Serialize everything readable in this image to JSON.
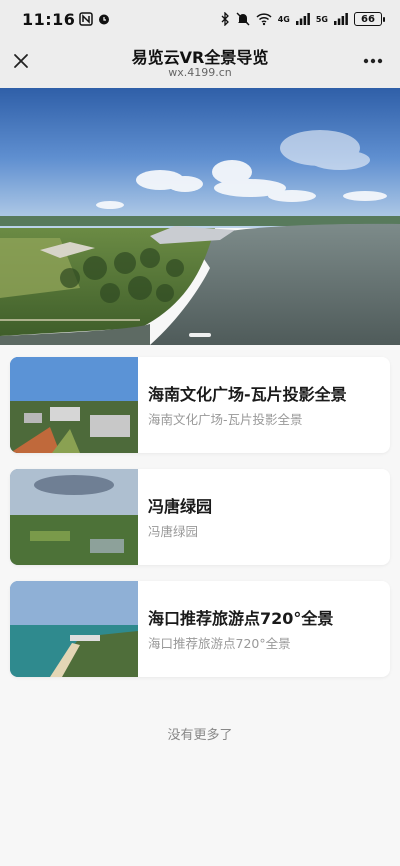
{
  "status_bar": {
    "time": "11:16",
    "battery": "66",
    "network_labels": [
      "4G",
      "5G"
    ]
  },
  "nav": {
    "title": "易览云VR全景导览",
    "url": "wx.4199.cn"
  },
  "hero": {
    "icon": "panorama-image",
    "active_slide": 1,
    "slide_count": 1
  },
  "list": {
    "items": [
      {
        "title": "海南文化广场-瓦片投影全景",
        "subtitle": "海南文化广场-瓦片投影全景",
        "icon": "thumbnail-city"
      },
      {
        "title": "冯唐绿园",
        "subtitle": "冯唐绿园",
        "icon": "thumbnail-park"
      },
      {
        "title": "海口推荐旅游点720°全景",
        "subtitle": "海口推荐旅游点720°全景",
        "icon": "thumbnail-beach"
      }
    ],
    "footer": "没有更多了"
  },
  "colors": {
    "header_bg": "#ededed",
    "page_bg": "#f7f7f7",
    "card_bg": "#ffffff",
    "subtitle": "#999999"
  }
}
